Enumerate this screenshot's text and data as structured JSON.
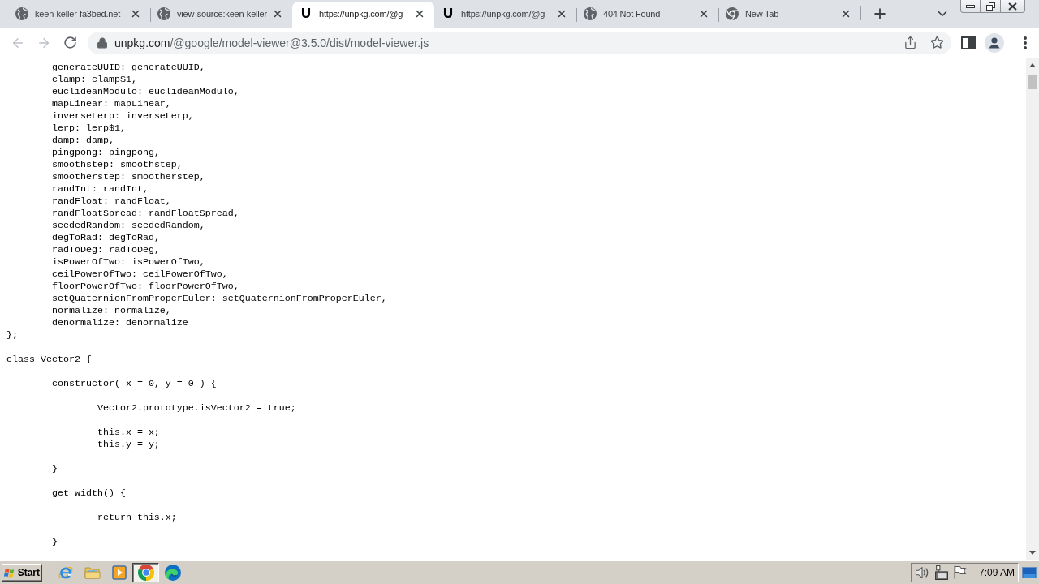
{
  "browser": {
    "tabs": [
      {
        "kind": "site",
        "title": "keen-keller-fa3bed.net",
        "selected": false
      },
      {
        "kind": "site",
        "title": "view-source:keen-keller",
        "selected": false
      },
      {
        "kind": "letter",
        "favicon_text": "U",
        "title": "https://unpkg.com/@g",
        "selected": true
      },
      {
        "kind": "letter",
        "favicon_text": "U",
        "title": "https://unpkg.com/@g",
        "selected": false
      },
      {
        "kind": "site",
        "title": "404 Not Found",
        "selected": false
      },
      {
        "kind": "newtab",
        "title": "New Tab",
        "selected": false
      }
    ],
    "nav": {
      "back": {
        "disabled": true
      },
      "forward": {
        "disabled": true
      }
    },
    "address_bar": {
      "host": "unpkg.com",
      "path": "/@google/model-viewer@3.5.0/dist/model-viewer.js"
    }
  },
  "code": {
    "blocks": [
      [
        "\tgenerateUUID: generateUUID,",
        "\tclamp: clamp$1,",
        "\teuclideanModulo: euclideanModulo,",
        "\tmapLinear: mapLinear,",
        "\tinverseLerp: inverseLerp,",
        "\tlerp: lerp$1,",
        "\tdamp: damp,",
        "\tpingpong: pingpong,",
        "\tsmoothstep: smoothstep,",
        "\tsmootherstep: smootherstep,",
        "\trandInt: randInt,",
        "\trandFloat: randFloat,",
        "\trandFloatSpread: randFloatSpread,",
        "\tseededRandom: seededRandom,",
        "\tdegToRad: degToRad,",
        "\tradToDeg: radToDeg,",
        "\tisPowerOfTwo: isPowerOfTwo,",
        "\tceilPowerOfTwo: ceilPowerOfTwo,",
        "\tfloorPowerOfTwo: floorPowerOfTwo,",
        "\tsetQuaternionFromProperEuler: setQuaternionFromProperEuler,",
        "\tnormalize: normalize,",
        "\tdenormalize: denormalize",
        "};"
      ],
      [
        "class Vector2 {"
      ],
      [
        "\tconstructor( x = 0, y = 0 ) {"
      ],
      [
        "\t\tVector2.prototype.isVector2 = true;"
      ],
      [
        "\t\tthis.x = x;",
        "\t\tthis.y = y;"
      ],
      [
        "\t}"
      ],
      [
        "\tget width() {"
      ],
      [
        "\t\treturn this.x;"
      ],
      [
        "\t}"
      ]
    ]
  },
  "taskbar": {
    "start": "Start",
    "apps": [
      {
        "kind": "ie",
        "selected": false
      },
      {
        "kind": "folder",
        "selected": false
      },
      {
        "kind": "media",
        "selected": false
      },
      {
        "kind": "chrome",
        "selected": true
      },
      {
        "kind": "edge",
        "selected": false
      }
    ],
    "clock": "7:09 AM"
  }
}
